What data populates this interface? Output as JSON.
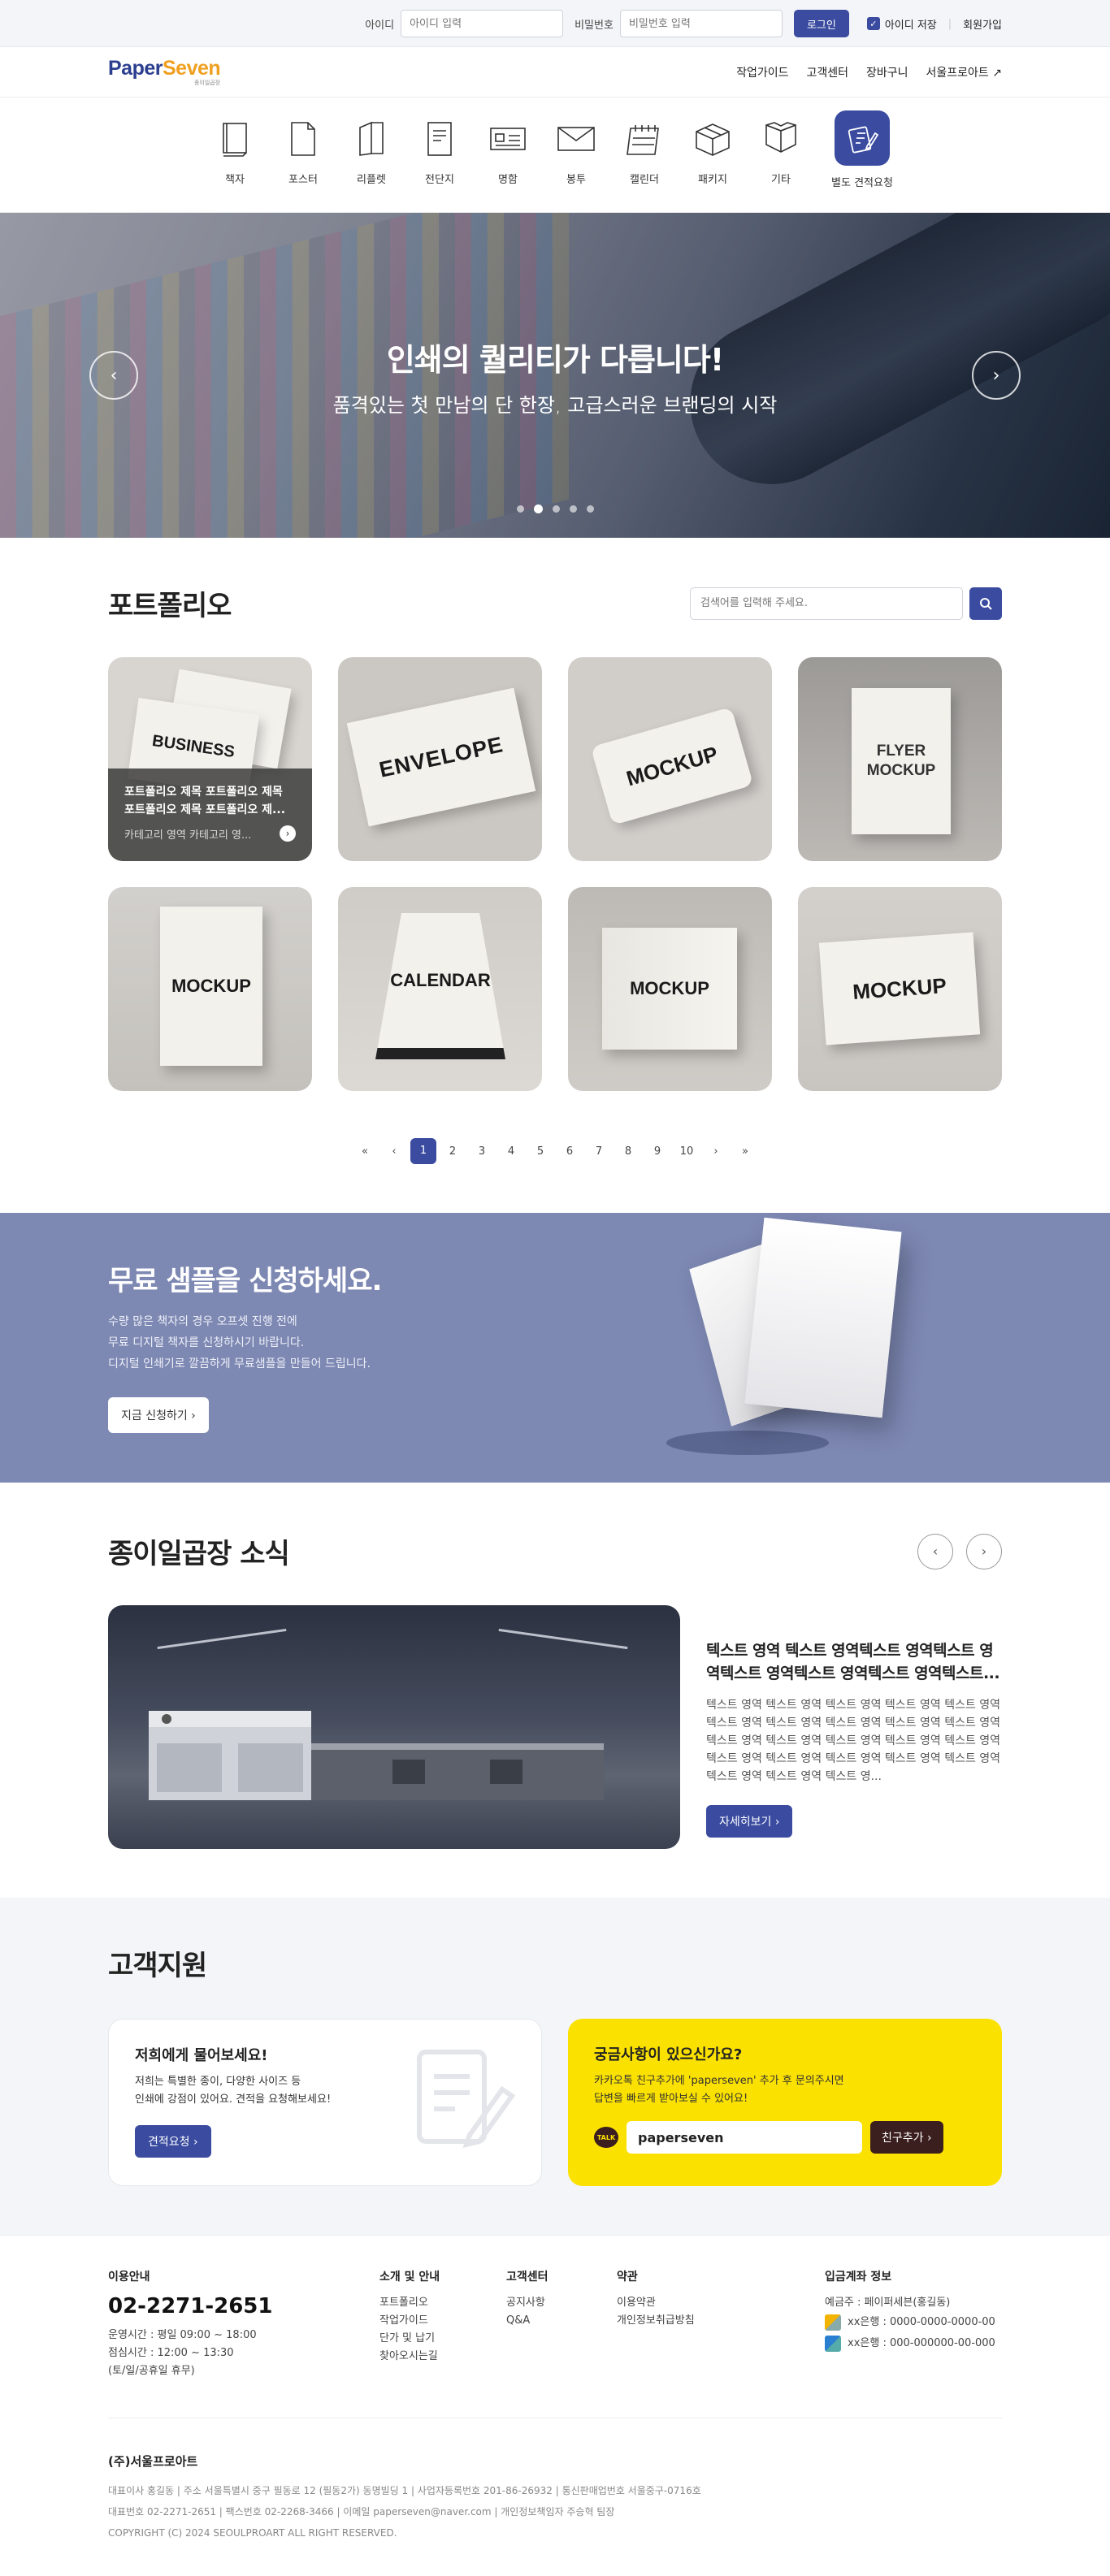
{
  "login": {
    "id_label": "아이디",
    "id_placeholder": "아이디 입력",
    "pw_label": "비밀번호",
    "pw_placeholder": "비밀번호 입력",
    "login_button": "로그인",
    "save_id": "아이디 저장",
    "signup": "회원가입"
  },
  "header": {
    "logo": "PaperSeven",
    "logo_sub": "종이일곱장",
    "nav": [
      "작업가이드",
      "고객센터",
      "장바구니",
      "서울프로아트 ↗"
    ]
  },
  "categories": [
    {
      "label": "책자",
      "icon": "book-icon"
    },
    {
      "label": "포스터",
      "icon": "poster-icon"
    },
    {
      "label": "리플렛",
      "icon": "leaflet-icon"
    },
    {
      "label": "전단지",
      "icon": "flyer-icon"
    },
    {
      "label": "명함",
      "icon": "business-card-icon"
    },
    {
      "label": "봉투",
      "icon": "envelope-icon"
    },
    {
      "label": "캘린더",
      "icon": "calendar-icon"
    },
    {
      "label": "패키지",
      "icon": "package-icon"
    },
    {
      "label": "기타",
      "icon": "box-icon"
    },
    {
      "label": "별도 견적요청",
      "icon": "quote-request-icon"
    }
  ],
  "hero": {
    "title": "인쇄의 퀄리티가 다릅니다!",
    "subtitle": "품격있는 첫 만남의 단 한장, 고급스러운 브랜딩의 시작",
    "slides": 5,
    "active_slide": 2
  },
  "portfolio": {
    "title": "포트폴리오",
    "search_placeholder": "검색어를 입력해 주세요.",
    "items": [
      {
        "mock": "BUSINESS",
        "hover_title": "포트폴리오 제목 포트폴리오 제목 포트폴리오 제목 포트폴리오 제...",
        "hover_category": "카테고리 영역 카테고리 영..."
      },
      {
        "mock": "ENVELOPE"
      },
      {
        "mock": "MOCKUP"
      },
      {
        "mock": "FLYER MOCKUP"
      },
      {
        "mock": "MOCKUP"
      },
      {
        "mock": "CALENDAR"
      },
      {
        "mock": "MOCKUP"
      },
      {
        "mock": "MOCKUP"
      }
    ],
    "pages": [
      "1",
      "2",
      "3",
      "4",
      "5",
      "6",
      "7",
      "8",
      "9",
      "10"
    ],
    "current_page": "1"
  },
  "sample": {
    "title": "무료 샘플을 신청하세요.",
    "lines": [
      "수량 많은 책자의 경우 오프셋 진행 전에",
      "무료 디지털 책자를 신청하시기 바랍니다.",
      "디지털 인쇄기로 깔끔하게 무료샘플을 만들어 드립니다."
    ],
    "button": "지금 신청하기 ›"
  },
  "news": {
    "title": "종이일곱장 소식",
    "headline": "텍스트 영역 텍스트 영역텍스트 영역텍스트 영역텍스트 영역텍스트 영역텍스트 영역텍스트...",
    "body": "텍스트 영역 텍스트 영역 텍스트 영역 텍스트 영역 텍스트 영역 텍스트 영역 텍스트 영역 텍스트 영역 텍스트 영역 텍스트 영역 텍스트 영역 텍스트 영역 텍스트 영역 텍스트 영역 텍스트 영역 텍스트 영역 텍스트 영역 텍스트 영역 텍스트 영역 텍스트 영역 텍스트 영역 텍스트 영역 텍스트 영...",
    "button": "자세히보기 ›"
  },
  "support": {
    "title": "고객지원",
    "left_title": "저희에게 물어보세요!",
    "left_lines": [
      "저희는 특별한 종이, 다양한 사이즈 등",
      "인쇄에 강점이 있어요. 견적을 요청해보세요!"
    ],
    "left_button": "견적요청 ›",
    "right_title": "궁금사항이 있으신가요?",
    "right_lines": [
      "카카오톡 친구추가에 'paperseven' 추가 후 문의주시면",
      "답변을 빠르게 받아보실 수 있어요!"
    ],
    "kakao_badge": "TALK",
    "kakao_id": "paperseven",
    "right_button": "친구추가 ›"
  },
  "footer": {
    "info_title": "이용안내",
    "phone": "02-2271-2651",
    "hours": [
      "운영시간 : 평일 09:00 ~ 18:00",
      "점심시간 : 12:00 ~ 13:30",
      "(토/일/공휴일 휴무)"
    ],
    "col2_title": "소개 및 안내",
    "col2_items": [
      "포트폴리오",
      "작업가이드",
      "단가 및 납기",
      "찾아오시는길"
    ],
    "col3_title": "고객센터",
    "col3_items": [
      "공지사항",
      "Q&A"
    ],
    "col4_title": "약관",
    "col4_items": [
      "이용약관",
      "개인정보취급방침"
    ],
    "bank_title": "입금계좌 정보",
    "holder": "예금주 : 페이퍼세븐(홍길동)",
    "banks": [
      "xx은행 : 0000-0000-0000-00",
      "xx은행 : 000-000000-00-000"
    ],
    "company": "(주)서울프로아트",
    "line1": "대표이사 홍길동 | 주소 서울특별시 중구 필동로 12 (필동2가) 동명빌딩 1 | 사업자등록번호 201-86-26932 | 통신판매업번호 서울중구-0716호",
    "line2": "대표번호 02-2271-2651 | 팩스번호 02-2268-3466 | 이메일 paperseven@naver.com | 개인정보책임자 주승혁 팀장",
    "copyright": "COPYRIGHT (C) 2024 SEOULPROART ALL RIGHT RESERVED."
  },
  "colors": {
    "primary": "#3a4ba0",
    "sample_bg": "#7d88b3",
    "kakao_yellow": "#fbe100"
  }
}
